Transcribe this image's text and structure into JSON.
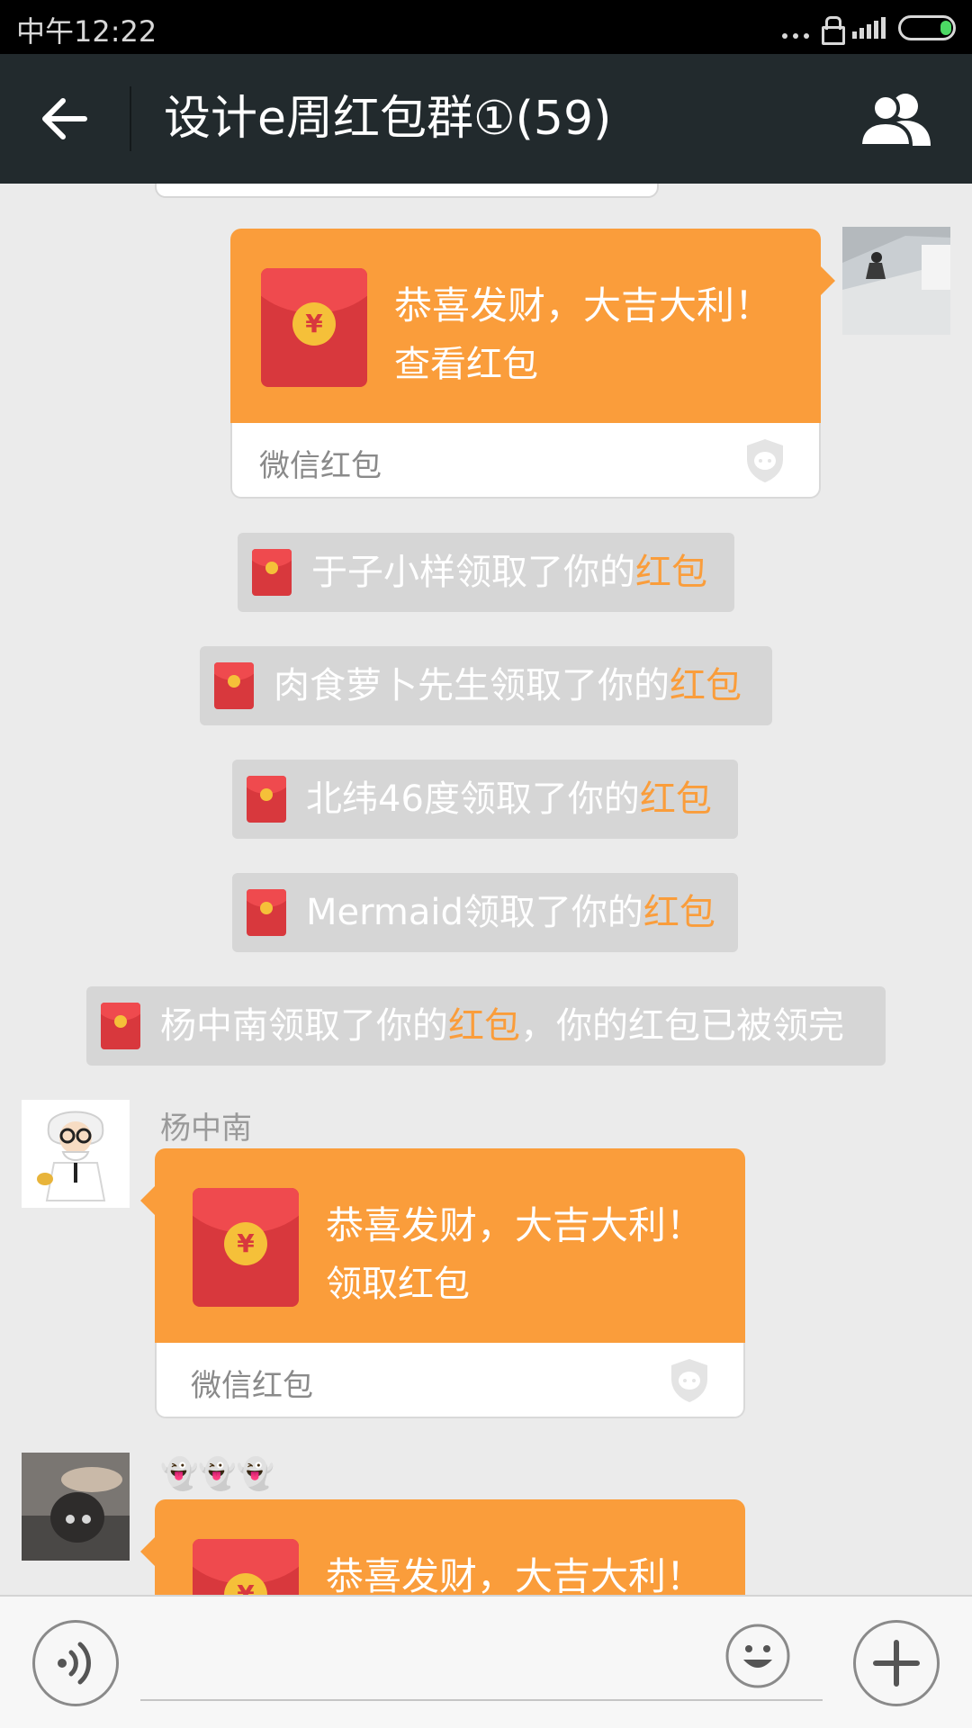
{
  "status_bar": {
    "time": "中午12:22"
  },
  "header": {
    "title": "设计e周红包群①(59)",
    "back_icon": "arrow-left-icon",
    "members_icon": "group-icon"
  },
  "messages": {
    "my_packet": {
      "greeting": "恭喜发财，大吉大利！",
      "action": "查看红包",
      "brand": "微信红包"
    },
    "system_notices": [
      {
        "name": "于子小样",
        "suffix": "领取了你的",
        "link": "红包",
        "extra": ""
      },
      {
        "name": "肉食萝卜先生",
        "suffix": "领取了你的",
        "link": "红包",
        "extra": ""
      },
      {
        "name": "北纬46度",
        "suffix": "领取了你的",
        "link": "红包",
        "extra": ""
      },
      {
        "name": "Mermaid",
        "suffix": "领取了你的",
        "link": "红包",
        "extra": ""
      },
      {
        "name": "杨中南",
        "suffix": "领取了你的",
        "link": "红包",
        "extra": "，你的红包已被领完"
      }
    ],
    "incoming_1": {
      "sender": "杨中南",
      "greeting": "恭喜发财，大吉大利！",
      "action": "领取红包",
      "brand": "微信红包"
    },
    "incoming_2": {
      "sender": "👻👻👻",
      "greeting": "恭喜发财，大吉大利！"
    }
  },
  "input_bar": {
    "voice_icon": "voice-icon",
    "emoji_icon": "emoji-icon",
    "more_icon": "plus-icon"
  },
  "colors": {
    "packet_orange": "#fa9d3b",
    "packet_red": "#d8383d",
    "header_bg": "#222a2d"
  }
}
